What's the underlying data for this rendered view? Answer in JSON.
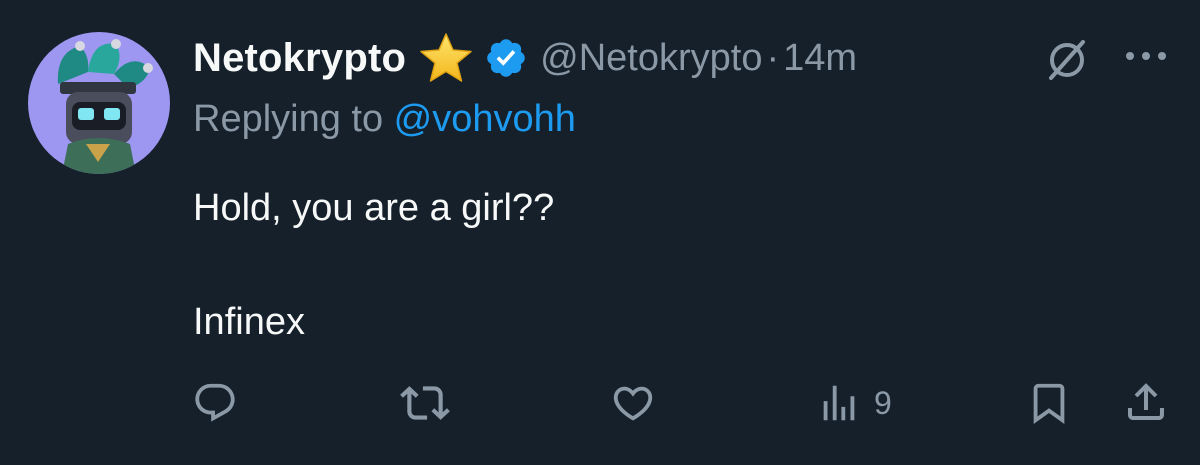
{
  "author": {
    "display_name": "Netokrypto",
    "handle": "@Netokrypto",
    "badges": [
      "star-icon",
      "verified-icon"
    ]
  },
  "tweet": {
    "separator": "·",
    "timestamp": "14m",
    "replying_prefix": "Replying to ",
    "replying_to": "@vohvohh",
    "text": "Hold, you are a girl??\n\nInfinex"
  },
  "actions": {
    "reply_icon": "reply-icon",
    "retweet_icon": "retweet-icon",
    "like_icon": "heart-icon",
    "views_icon": "analytics-icon",
    "views_count": "9",
    "bookmark_icon": "bookmark-icon",
    "share_icon": "share-icon"
  },
  "colors": {
    "background": "#15202b",
    "text": "#f7f9f9",
    "secondary": "#8b98a5",
    "accent": "#1d9bf0",
    "star": "#f9c928"
  }
}
